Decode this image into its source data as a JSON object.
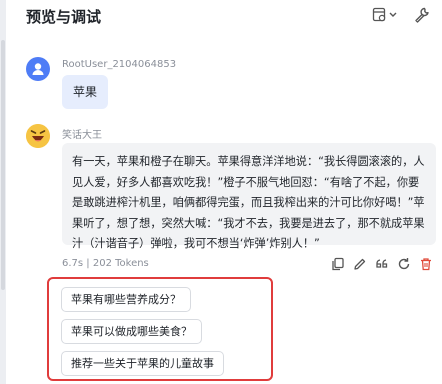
{
  "header": {
    "title": "预览与调试"
  },
  "conversation": {
    "user": {
      "name": "RootUser_2104064853",
      "message": "苹果"
    },
    "bot": {
      "name": "笑话大王",
      "message": "有一天，苹果和橙子在聊天。苹果得意洋洋地说：“我长得圆滚滚的，人见人爱，好多人都喜欢吃我！”橙子不服气地回怼：“有啥了不起，你要是敢跳进榨汁机里，咱俩都得完蛋，而且我榨出来的汁可比你好喝！”苹果听了，想了想，突然大喊：“我才不去，我要是进去了，那不就成苹果汁（汁谐音子）弹啦，我可不想当‘炸弹’炸别人！”",
      "meta": "6.7s | 202 Tokens"
    }
  },
  "suggestions": [
    "苹果有哪些营养成分？",
    "苹果可以做成哪些美食？",
    "推荐一些关于苹果的儿童故事"
  ],
  "colors": {
    "user_avatar": "#4e7cf6",
    "user_bubble": "#e6edfd",
    "bot_bubble": "#f2f3f5",
    "highlight_border": "#e03c3c",
    "delete_icon": "#e04a3a"
  }
}
